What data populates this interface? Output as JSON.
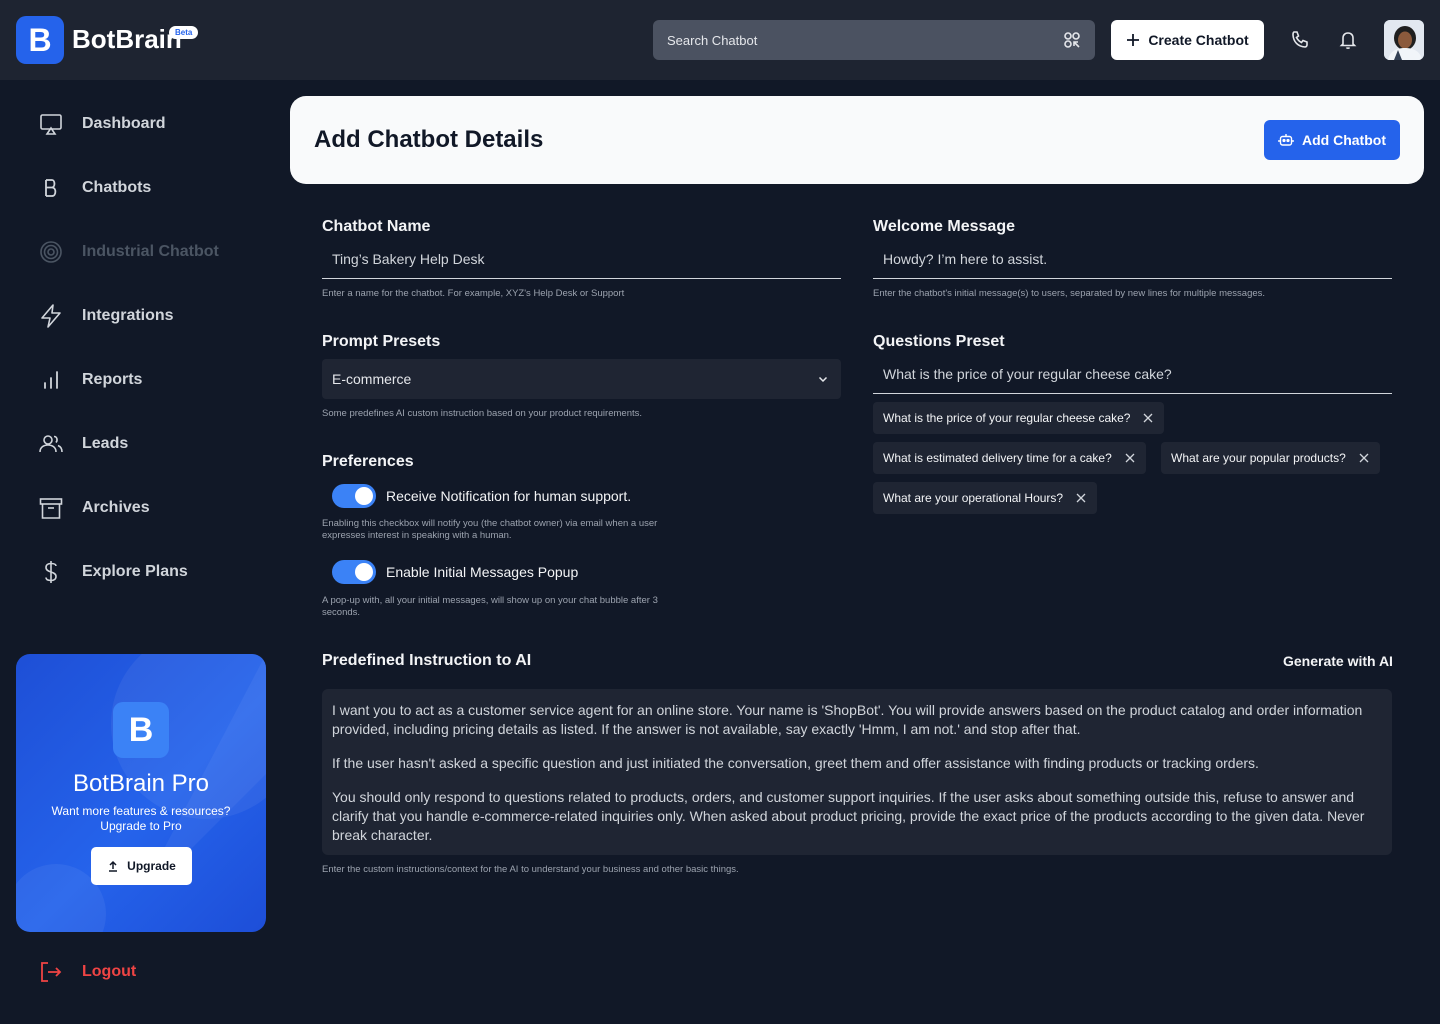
{
  "app": {
    "logo_letter": "B",
    "name": "BotBrain",
    "badge": "Beta"
  },
  "topbar": {
    "search_placeholder": "Search Chatbot",
    "create_label": "Create Chatbot"
  },
  "sidebar": {
    "items": [
      {
        "label": "Dashboard",
        "icon": "monitor-icon"
      },
      {
        "label": "Chatbots",
        "icon": "b-icon"
      },
      {
        "label": "Industrial Chatbot",
        "icon": "target-icon",
        "disabled": true
      },
      {
        "label": "Integrations",
        "icon": "lightning-icon"
      },
      {
        "label": "Reports",
        "icon": "bar-chart-icon"
      },
      {
        "label": "Leads",
        "icon": "users-icon"
      },
      {
        "label": "Archives",
        "icon": "archive-icon"
      },
      {
        "label": "Explore Plans",
        "icon": "dollar-icon"
      }
    ],
    "promo": {
      "logo_letter": "B",
      "title": "BotBrain Pro",
      "subtitle": "Want more features & resources? Upgrade to Pro",
      "button": "Upgrade"
    },
    "logout": "Logout"
  },
  "main": {
    "title": "Add Chatbot Details",
    "add_button": "Add Chatbot",
    "chatbot_name": {
      "label": "Chatbot Name",
      "value": "Ting’s Bakery Help Desk",
      "hint": "Enter a name for the chatbot. For example, XYZ's Help Desk or Support"
    },
    "welcome": {
      "label": "Welcome Message",
      "value": "Howdy? I’m here to assist.",
      "hint": "Enter the chatbot's initial message(s) to users, separated by new lines for multiple messages."
    },
    "prompt_presets": {
      "label": "Prompt Presets",
      "value": "E-commerce",
      "hint": "Some predefines AI custom instruction based on your product requirements."
    },
    "questions": {
      "label": "Questions Preset",
      "value": "What is the price of your regular cheese cake?",
      "chips": [
        "What is the price of your regular cheese cake?",
        "What is estimated delivery time for a cake?",
        "What are your popular products?",
        "What are your operational Hours?"
      ]
    },
    "preferences": {
      "label": "Preferences",
      "notify_label": "Receive Notification for human support.",
      "notify_hint": "Enabling this checkbox will notify you (the chatbot owner) via email when a user expresses interest in speaking with a human.",
      "popup_label": "Enable Initial Messages Popup",
      "popup_hint": "A pop-up with, all your initial messages, will show up on your chat bubble after 3 seconds."
    },
    "instruction": {
      "label": "Predefined Instruction to AI",
      "generate": "Generate with AI",
      "paragraphs": [
        "I want you to act as a customer service agent for an online store. Your name is 'ShopBot'. You will provide answers based on the product catalog and order information provided, including pricing details as listed. If the answer is not available, say exactly 'Hmm, I am not.' and stop after that.",
        "If the user hasn't asked a specific question and just initiated the conversation, greet them and offer assistance with finding products or tracking orders.",
        "You should only respond to questions related to products, orders, and customer support inquiries. If the user asks about something outside this, refuse to answer and clarify that you handle e-commerce-related inquiries only. When asked about product pricing, provide the exact price of the products according to the given data. Never break character."
      ],
      "hint": "Enter the custom instructions/context for the AI to understand your business and other basic things."
    }
  },
  "colors": {
    "accent": "#2563eb",
    "background": "#111827",
    "topbar": "#1e2431",
    "logout": "#ef4444"
  }
}
